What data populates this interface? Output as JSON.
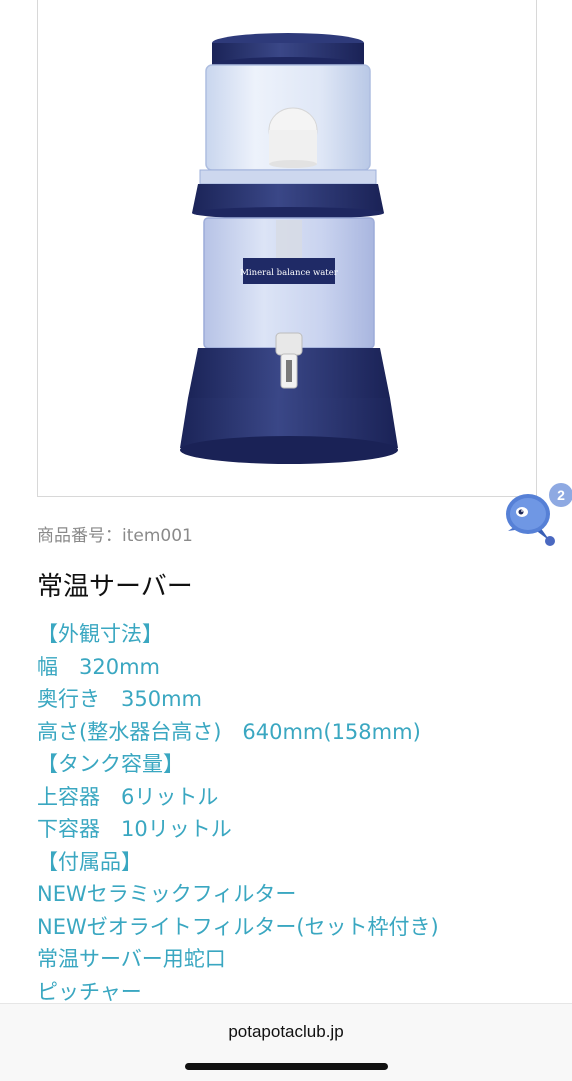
{
  "product": {
    "image_label": "Mineral balance water",
    "number_label": "商品番号：",
    "number_value": "item001",
    "title": "常温サーバー",
    "description_lines": [
      "【外観寸法】",
      "幅　320mm",
      "奥行き　350mm",
      "高さ(整水器台高さ)　640mm(158mm)",
      "【タンク容量】",
      "上容器　6リットル",
      "下容器　10リットル",
      "【付属品】",
      "NEWセラミックフィルター",
      "NEWゼオライトフィルター(セット枠付き)",
      "常温サーバー用蛇口",
      "ピッチャー"
    ]
  },
  "chat_widget": {
    "badge_count": "2",
    "icon": "chat-bot-icon",
    "badge_color": "#8ea9e2"
  },
  "browser": {
    "url": "potapotaclub.jp"
  },
  "colors": {
    "description_text": "#3aa7c1",
    "title_text": "#111111",
    "meta_text": "#8a8a8a",
    "product_navy": "#26306a"
  }
}
